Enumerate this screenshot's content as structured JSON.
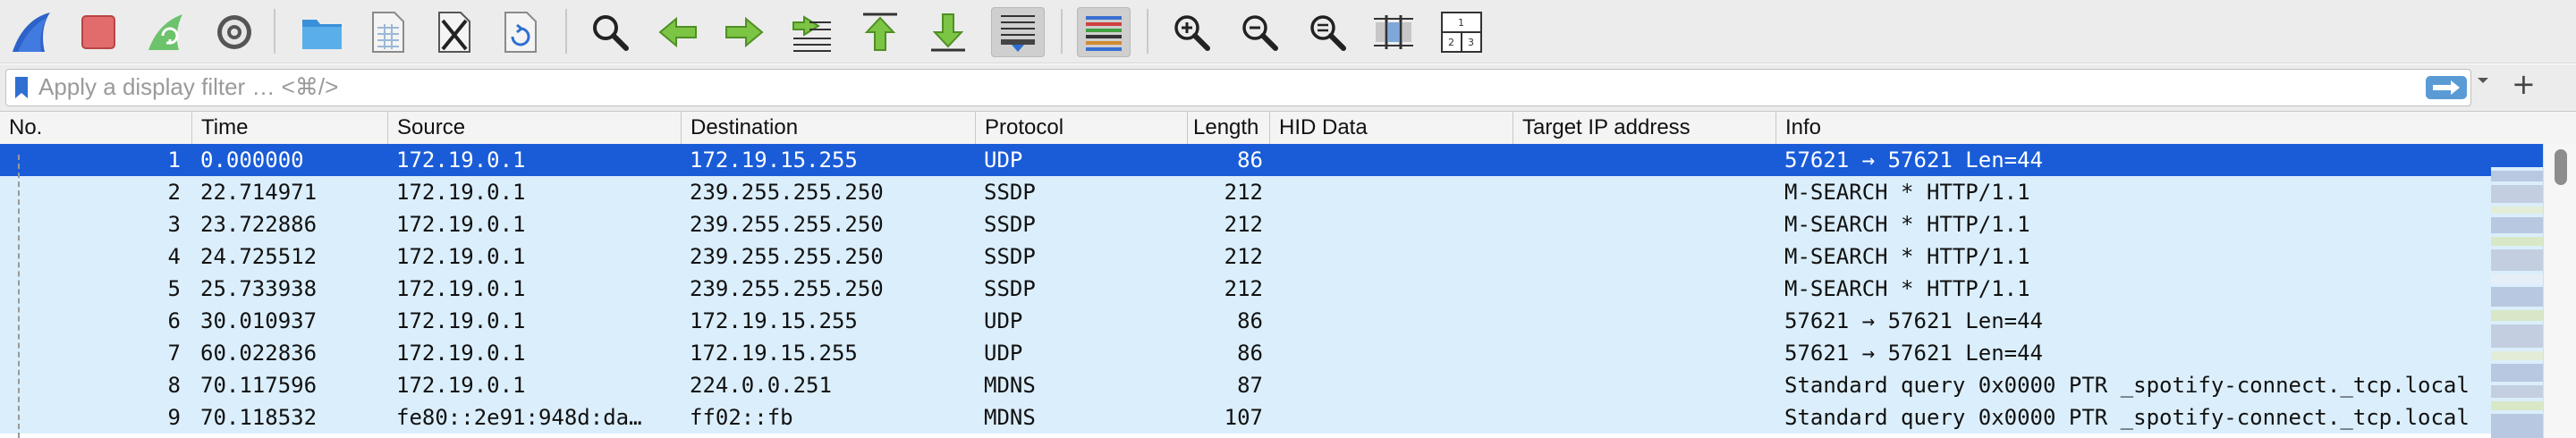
{
  "filter": {
    "placeholder": "Apply a display filter … <⌘/>"
  },
  "columns": [
    "No.",
    "Time",
    "Source",
    "Destination",
    "Protocol",
    "Length",
    "HID Data",
    "Target IP address",
    "Info"
  ],
  "packets": [
    {
      "no": "1",
      "time": "0.000000",
      "source": "172.19.0.1",
      "destination": "172.19.15.255",
      "protocol": "UDP",
      "length": "86",
      "hid": "",
      "target_ip": "",
      "info": "57621 → 57621 Len=44"
    },
    {
      "no": "2",
      "time": "22.714971",
      "source": "172.19.0.1",
      "destination": "239.255.255.250",
      "protocol": "SSDP",
      "length": "212",
      "hid": "",
      "target_ip": "",
      "info": "M-SEARCH * HTTP/1.1"
    },
    {
      "no": "3",
      "time": "23.722886",
      "source": "172.19.0.1",
      "destination": "239.255.255.250",
      "protocol": "SSDP",
      "length": "212",
      "hid": "",
      "target_ip": "",
      "info": "M-SEARCH * HTTP/1.1"
    },
    {
      "no": "4",
      "time": "24.725512",
      "source": "172.19.0.1",
      "destination": "239.255.255.250",
      "protocol": "SSDP",
      "length": "212",
      "hid": "",
      "target_ip": "",
      "info": "M-SEARCH * HTTP/1.1"
    },
    {
      "no": "5",
      "time": "25.733938",
      "source": "172.19.0.1",
      "destination": "239.255.255.250",
      "protocol": "SSDP",
      "length": "212",
      "hid": "",
      "target_ip": "",
      "info": "M-SEARCH * HTTP/1.1"
    },
    {
      "no": "6",
      "time": "30.010937",
      "source": "172.19.0.1",
      "destination": "172.19.15.255",
      "protocol": "UDP",
      "length": "86",
      "hid": "",
      "target_ip": "",
      "info": "57621 → 57621 Len=44"
    },
    {
      "no": "7",
      "time": "60.022836",
      "source": "172.19.0.1",
      "destination": "172.19.15.255",
      "protocol": "UDP",
      "length": "86",
      "hid": "",
      "target_ip": "",
      "info": "57621 → 57621 Len=44"
    },
    {
      "no": "8",
      "time": "70.117596",
      "source": "172.19.0.1",
      "destination": "224.0.0.251",
      "protocol": "MDNS",
      "length": "87",
      "hid": "",
      "target_ip": "",
      "info": "Standard query 0x0000 PTR _spotify-connect._tcp.local"
    },
    {
      "no": "9",
      "time": "70.118532",
      "source": "fe80::2e91:948d:da…",
      "destination": "ff02::fb",
      "protocol": "MDNS",
      "length": "107",
      "hid": "",
      "target_ip": "",
      "info": "Standard query 0x0000 PTR _spotify-connect._tcp.local"
    }
  ],
  "colors": {
    "row_bg": "#dbeefb",
    "selected_bg": "#1a5cd8",
    "toolbar_bg": "#ececec"
  },
  "toolbar_icons": [
    "shark-fin-start-icon",
    "stop-capture-icon",
    "restart-capture-icon",
    "capture-options-icon",
    "open-file-icon",
    "save-file-icon",
    "close-file-icon",
    "reload-file-icon",
    "find-packet-icon",
    "go-back-icon",
    "go-forward-icon",
    "go-to-packet-icon",
    "go-first-packet-icon",
    "go-last-packet-icon",
    "auto-scroll-icon",
    "colorize-icon",
    "zoom-in-icon",
    "zoom-out-icon",
    "normal-size-icon",
    "resize-columns-icon",
    "layout-panes-icon"
  ]
}
